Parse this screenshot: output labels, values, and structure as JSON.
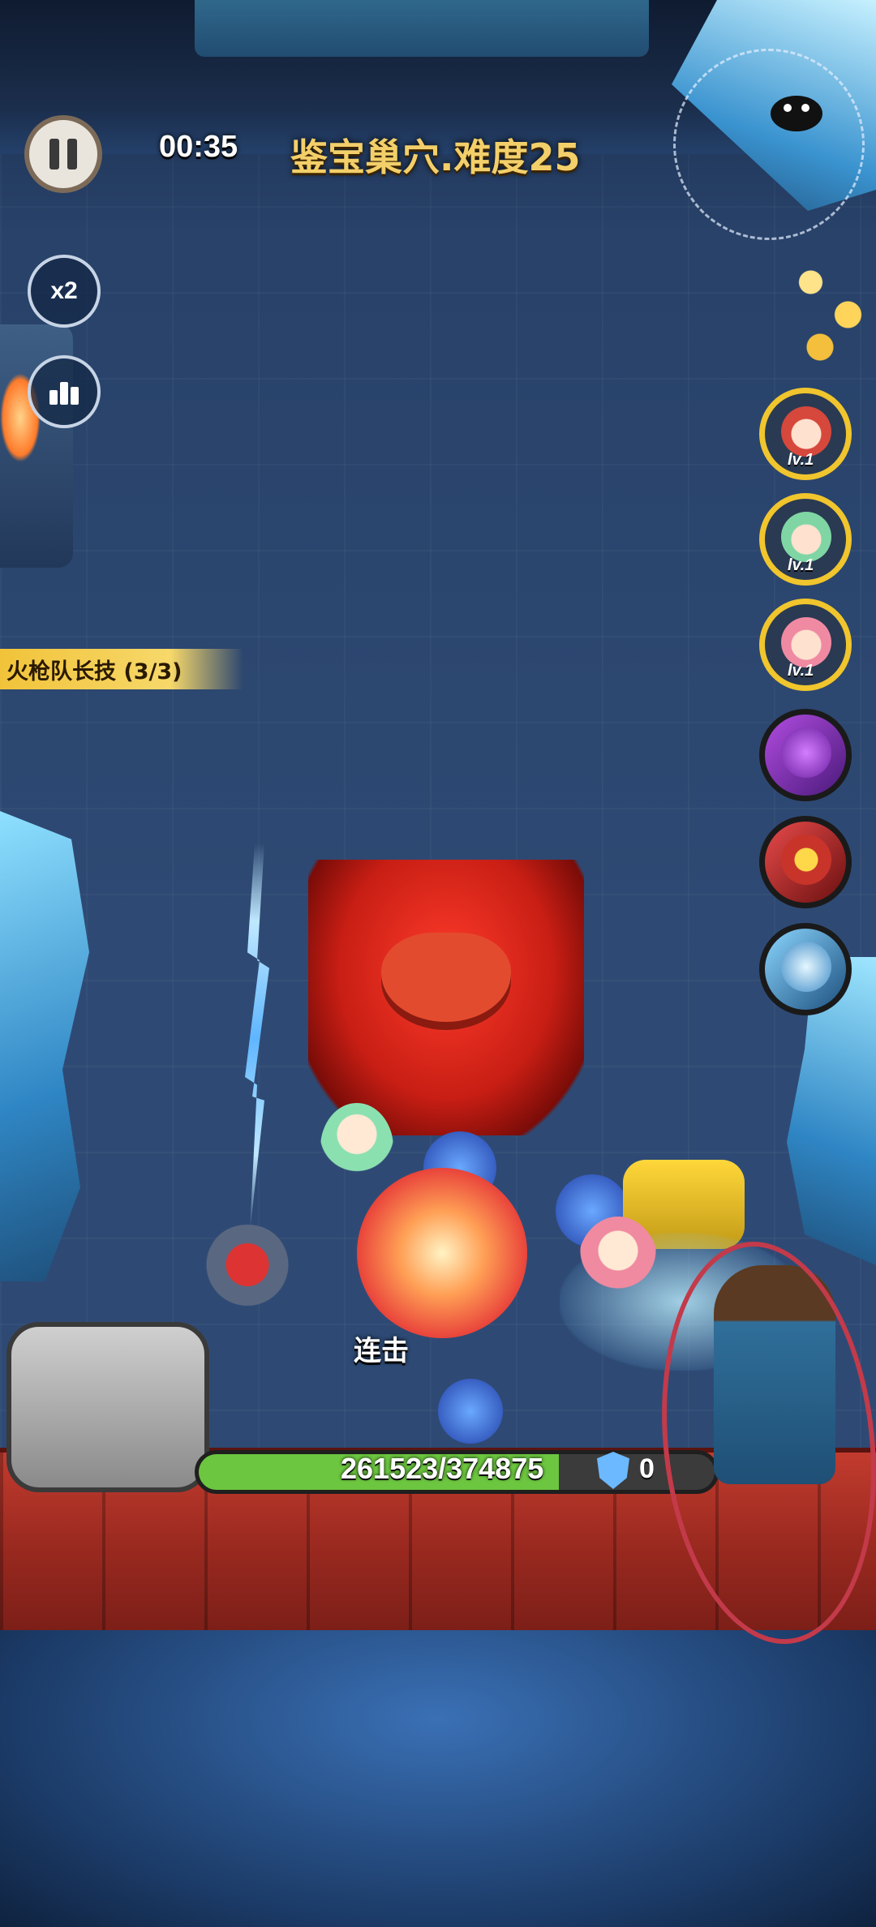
{
  "hud": {
    "pause_icon": "pause-icon",
    "timer": "00:35",
    "stage_title": "鉴宝巢穴.难度25",
    "speed_label": "x2",
    "stats_icon": "bar-chart-icon"
  },
  "skill_banner": {
    "label": "火枪队长技 (3/3)"
  },
  "skill_column": [
    {
      "type": "hero",
      "level": "lv.1",
      "icon": "red-hair-pirate-hero-icon"
    },
    {
      "type": "hero",
      "level": "lv.1",
      "icon": "green-hair-hero-icon"
    },
    {
      "type": "hero",
      "level": "lv.1",
      "icon": "pink-hair-lancer-hero-icon"
    },
    {
      "type": "skill",
      "icon": "purple-worm-skill-icon"
    },
    {
      "type": "skill",
      "icon": "star-punch-skill-icon"
    },
    {
      "type": "skill",
      "icon": "ice-wave-skill-icon"
    }
  ],
  "battle": {
    "combo_label": "连击",
    "boss_icon": "red-demon-boss-icon"
  },
  "base": {
    "hp_current": 261523,
    "hp_max": 374875,
    "hp_text": "261523/374875",
    "shield_value": "0",
    "hp_color": "#6cc63f"
  },
  "annotation": {
    "color": "#c33a4a",
    "target": "mage-hero"
  }
}
